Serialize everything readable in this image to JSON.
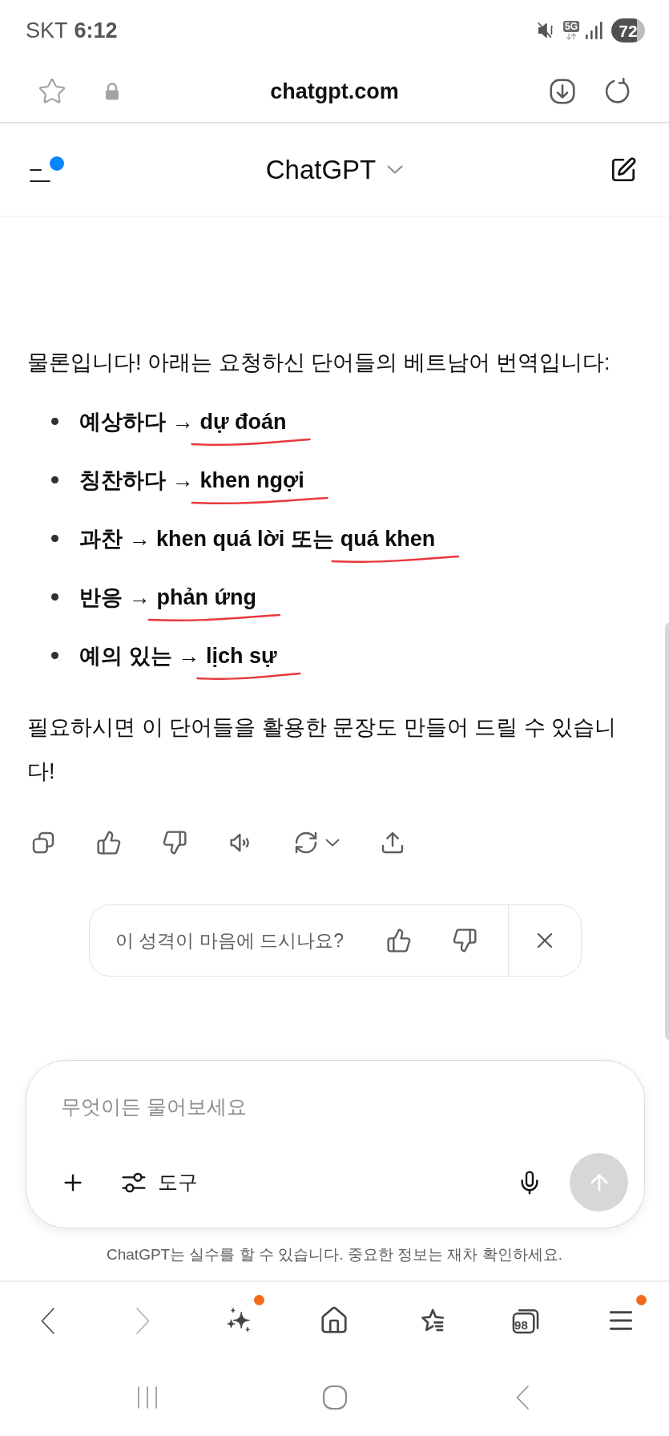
{
  "status_bar": {
    "carrier": "SKT",
    "time": "6:12",
    "network": "5G",
    "battery": "72"
  },
  "browser_bar": {
    "url": "chatgpt.com"
  },
  "chat_header": {
    "title": "ChatGPT",
    "menu_badge": true
  },
  "message": {
    "intro": "물론입니다! 아래는 요청하신 단어들의 베트남어 번역입니다:",
    "items": [
      {
        "segments": [
          {
            "text": "예상하다 →",
            "underlined": false
          },
          {
            "text": "dự đoán",
            "underlined": true
          }
        ]
      },
      {
        "segments": [
          {
            "text": "칭찬하다 →",
            "underlined": false
          },
          {
            "text": "khen ngợi",
            "underlined": true
          }
        ]
      },
      {
        "segments": [
          {
            "text": "과찬 → khen quá lời 또는",
            "underlined": false
          },
          {
            "text": "quá khen",
            "underlined": true
          }
        ]
      },
      {
        "segments": [
          {
            "text": "반응 →",
            "underlined": false
          },
          {
            "text": "phản ứng",
            "underlined": true
          }
        ]
      },
      {
        "segments": [
          {
            "text": "예의 있는 →",
            "underlined": false
          },
          {
            "text": "lịch sự",
            "underlined": true
          }
        ]
      }
    ],
    "outro": "필요하시면 이 단어들을 활용한 문장도 만들어 드릴 수 있습니다!"
  },
  "message_actions": [
    {
      "kind": "copy"
    },
    {
      "kind": "like"
    },
    {
      "kind": "dislike"
    },
    {
      "kind": "read_aloud"
    },
    {
      "kind": "regenerate"
    },
    {
      "kind": "share"
    }
  ],
  "feedback_prompt": {
    "question": "이 성격이 마음에 드시나요?"
  },
  "composer": {
    "placeholder": "무엇이든 물어보세요",
    "tools_label": "도구",
    "send_disabled": true
  },
  "disclaimer": "ChatGPT는 실수를 할 수 있습니다. 중요한 정보는 재차 확인하세요.",
  "bottom_nav": [
    {
      "kind": "back",
      "disabled": false,
      "badge": false
    },
    {
      "kind": "forward",
      "disabled": true,
      "badge": false
    },
    {
      "kind": "assistant",
      "disabled": false,
      "badge": true
    },
    {
      "kind": "home",
      "disabled": false,
      "badge": false
    },
    {
      "kind": "bookmarks",
      "disabled": false,
      "badge": false
    },
    {
      "kind": "tabs",
      "label": "98",
      "disabled": false,
      "badge": false
    },
    {
      "kind": "menu",
      "disabled": false,
      "badge": true
    }
  ],
  "system_nav": [
    {
      "kind": "recents"
    },
    {
      "kind": "home"
    },
    {
      "kind": "back"
    }
  ]
}
